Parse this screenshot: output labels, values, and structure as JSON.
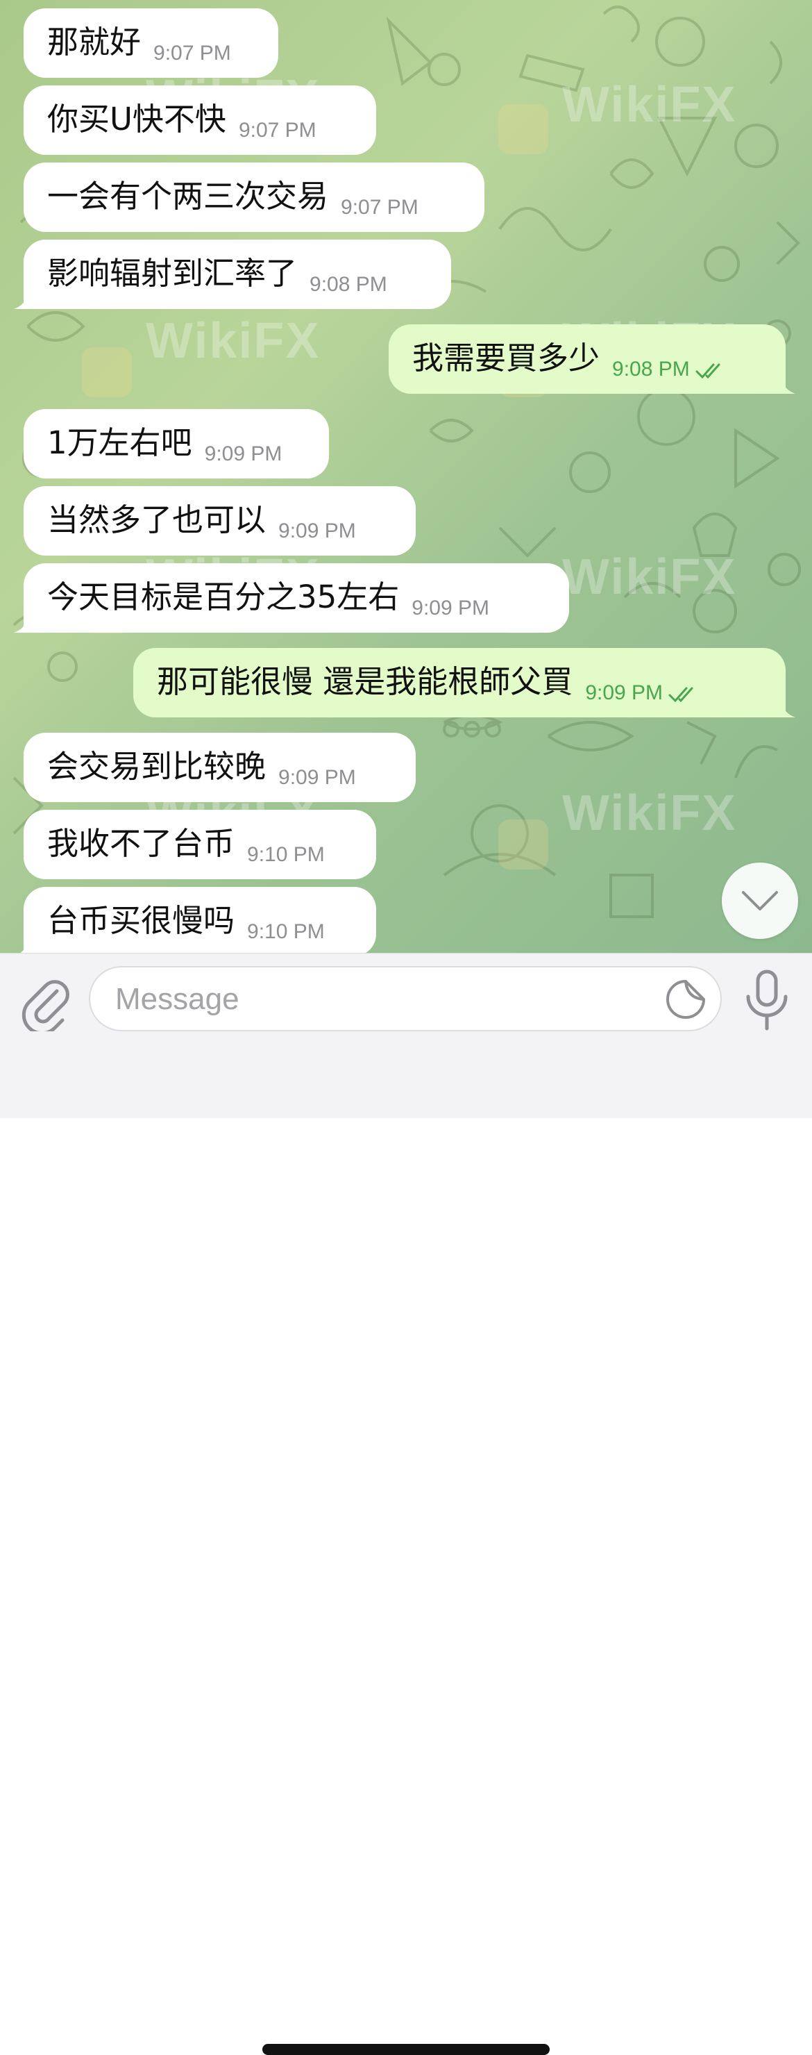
{
  "messages": [
    {
      "direction": "incoming",
      "text": "那就好",
      "time": "9:07 PM",
      "tail": false
    },
    {
      "direction": "incoming",
      "text": "你买U快不快",
      "time": "9:07 PM",
      "tail": false
    },
    {
      "direction": "incoming",
      "text": "一会有个两三次交易",
      "time": "9:07 PM",
      "tail": false
    },
    {
      "direction": "incoming",
      "text": "影响辐射到汇率了",
      "time": "9:08 PM",
      "tail": true
    },
    {
      "direction": "outgoing",
      "text": "我需要買多少",
      "time": "9:08 PM",
      "status": "read",
      "tail": true
    },
    {
      "direction": "incoming",
      "text": "1万左右吧",
      "time": "9:09 PM",
      "tail": false
    },
    {
      "direction": "incoming",
      "text": "当然多了也可以",
      "time": "9:09 PM",
      "tail": false
    },
    {
      "direction": "incoming",
      "text": "今天目标是百分之35左右",
      "time": "9:09 PM",
      "tail": true
    },
    {
      "direction": "outgoing",
      "text": "那可能很慢 還是我能根師父買",
      "time": "9:09 PM",
      "status": "read",
      "tail": true
    },
    {
      "direction": "incoming",
      "text": "会交易到比较晚",
      "time": "9:09 PM",
      "tail": false
    },
    {
      "direction": "incoming",
      "text": "我收不了台币",
      "time": "9:10 PM",
      "tail": false
    },
    {
      "direction": "incoming",
      "text": "台币买很慢吗",
      "time": "9:10 PM",
      "tail": true
    }
  ],
  "composer": {
    "placeholder": "Message",
    "attach_icon": "paperclip-icon",
    "sticker_icon": "sticker-icon",
    "mic_icon": "microphone-icon"
  },
  "scroll_button_icon": "chevron-down-icon",
  "watermark": "WikiFX",
  "colors": {
    "incoming_bubble": "#ffffff",
    "outgoing_bubble": "#e2fbc8",
    "outgoing_time": "#4aa54f",
    "incoming_time": "#8e8e93"
  }
}
